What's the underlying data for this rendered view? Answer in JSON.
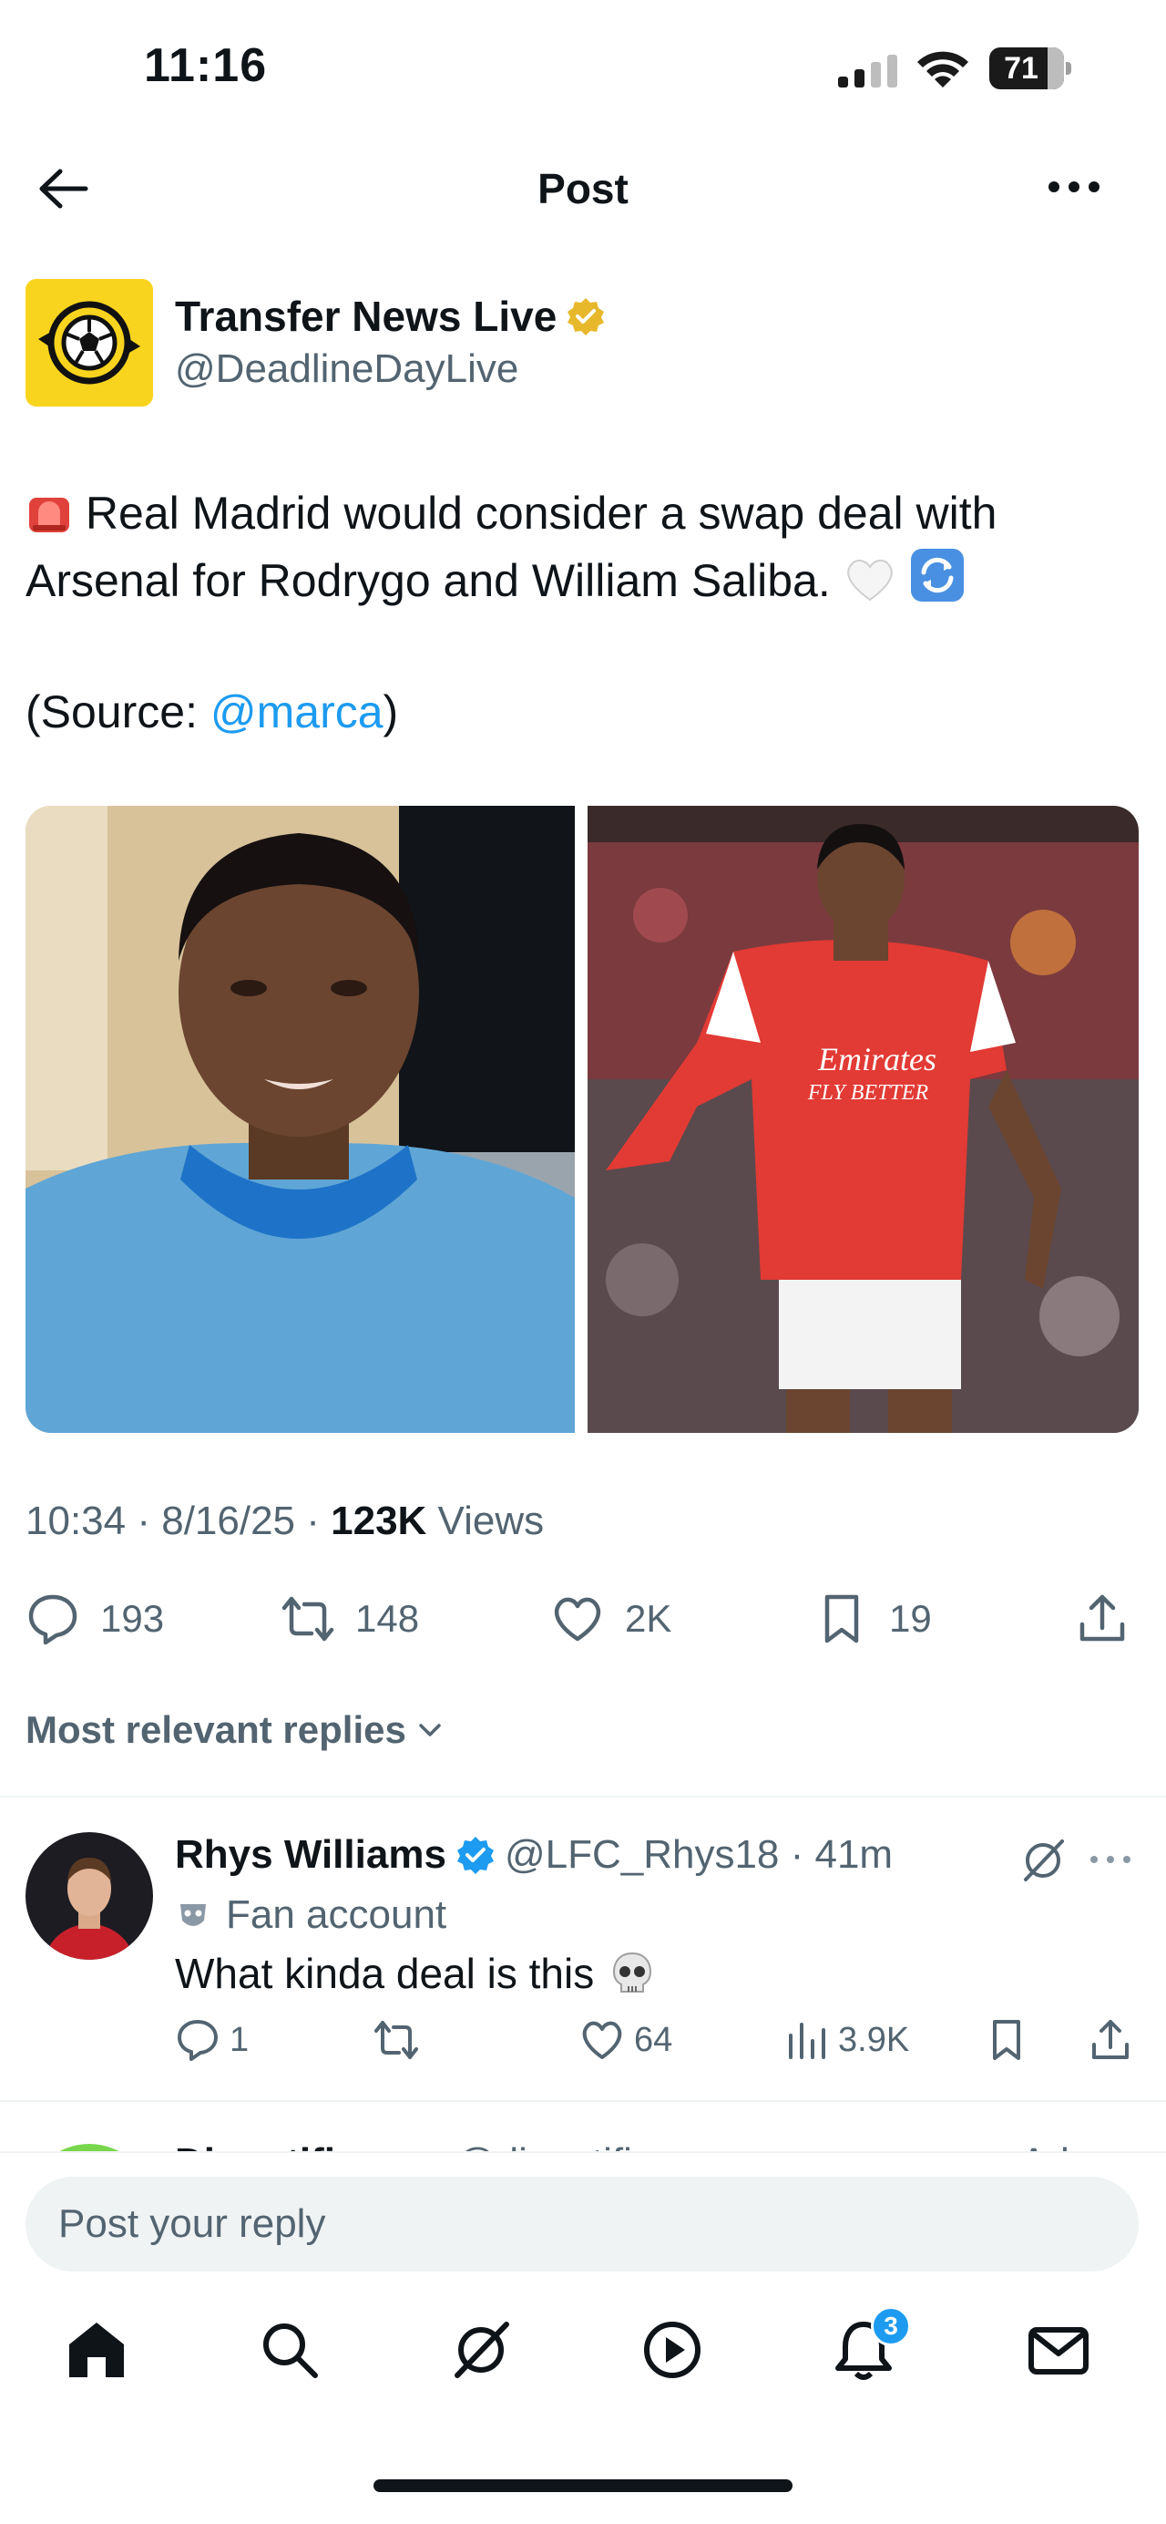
{
  "status_bar": {
    "time": "11:16",
    "battery": "71"
  },
  "header": {
    "title": "Post"
  },
  "author": {
    "name": "Transfer News Live",
    "handle": "@DeadlineDayLive"
  },
  "tweet": {
    "line1": "Real Madrid would consider a swap deal with",
    "line2": "Arsenal for Rodrygo and William Saliba.",
    "source_prefix": "(Source: ",
    "source_mention": "@marca",
    "source_suffix": ")",
    "sponsor_text_1": "Emirates",
    "sponsor_text_2": "FLY BETTER"
  },
  "meta": {
    "time": "10:34",
    "date": "8/16/25",
    "views_count": "123K",
    "views_label": " Views"
  },
  "actions": {
    "replies": "193",
    "reposts": "148",
    "likes": "2K",
    "bookmarks": "19"
  },
  "replies_filter": {
    "label": "Most relevant replies"
  },
  "reply": {
    "name": "Rhys Williams",
    "handle": "@LFC_Rhys18 · 41m",
    "badge_label": "Fan account",
    "text": "What kinda deal is this",
    "replies": "1",
    "likes": "64",
    "views": "3.9K"
  },
  "next_reply": {
    "name": "Disputifier",
    "handle": "@disputifier",
    "tag": "Ad"
  },
  "composer": {
    "placeholder": "Post your reply"
  },
  "nav": {
    "notifications_badge": "3"
  },
  "colors": {
    "accent": "#1d9bf0",
    "text": "#0f1419",
    "muted": "#536471",
    "brand_yellow": "#f9d41e",
    "gold_verified": "#e8b82c"
  }
}
